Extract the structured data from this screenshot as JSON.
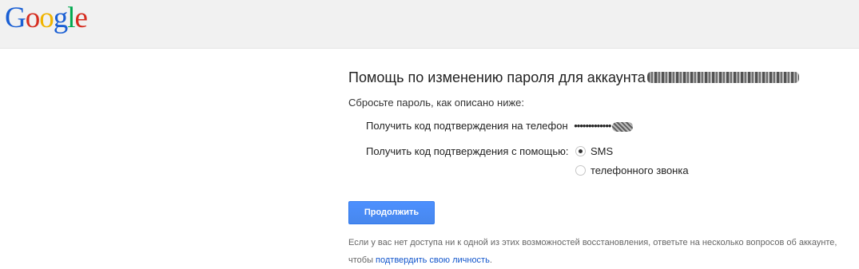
{
  "header": {
    "logo_letters": [
      {
        "char": "G",
        "color": "#1a5fd4"
      },
      {
        "char": "o",
        "color": "#d62d20"
      },
      {
        "char": "o",
        "color": "#f0b400"
      },
      {
        "char": "g",
        "color": "#1a5fd4"
      },
      {
        "char": "l",
        "color": "#00a94f"
      },
      {
        "char": "e",
        "color": "#d62d20"
      }
    ]
  },
  "main": {
    "title": "Помощь по изменению пароля для аккаунта",
    "subtitle": "Сбросьте пароль, как описано ниже:",
    "phone_label": "Получить код подтверждения на телефон",
    "phone_value": "•••••••••••••",
    "method_label": "Получить код подтверждения с помощью:",
    "options": [
      {
        "label": "SMS",
        "selected": true
      },
      {
        "label": "телефонного звонка",
        "selected": false
      }
    ],
    "continue_label": "Продолжить",
    "footer_text": "Если у вас нет доступа ни к одной из этих возможностей восстановления, ответьте на несколько вопросов об аккаунте, чтобы",
    "footer_link": "подтвердить свою личность",
    "footer_end": "."
  },
  "colors": {
    "header_bg": "#f1f1f1",
    "button_blue": "#4d90fe",
    "link_blue": "#1155cc"
  }
}
